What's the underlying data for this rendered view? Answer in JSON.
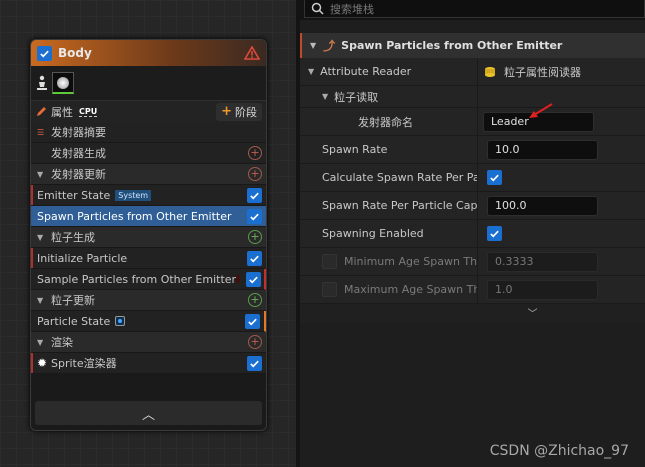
{
  "search": {
    "placeholder": "搜索堆栈"
  },
  "node": {
    "title": "Body",
    "attr_label": "属性",
    "attr_badge": "CPU",
    "stage_label": "阶段",
    "rows": [
      {
        "type": "summary",
        "label": "发射器摘要"
      },
      {
        "type": "item",
        "label": "发射器生成",
        "control": "add",
        "centered": true
      },
      {
        "type": "sect",
        "label": "发射器更新",
        "control": "add"
      },
      {
        "type": "item",
        "label": "Emitter State",
        "pill": "System",
        "control": "check",
        "bar": true
      },
      {
        "type": "item",
        "label": "Spawn Particles from Other Emitter",
        "control": "check",
        "selected": true
      },
      {
        "type": "sect",
        "label": "粒子生成",
        "control": "add-green"
      },
      {
        "type": "item",
        "label": "Initialize Particle",
        "control": "check",
        "bar": true
      },
      {
        "type": "item",
        "label": "Sample Particles from Other Emitter",
        "control": "check",
        "red": true
      },
      {
        "type": "sect",
        "label": "粒子更新",
        "control": "add-green"
      },
      {
        "type": "item",
        "label": "Particle State",
        "control": "check",
        "blue": true
      },
      {
        "type": "sect",
        "label": "渲染",
        "control": "add"
      },
      {
        "type": "item",
        "label": "Sprite渲染器",
        "control": "check",
        "spark": true,
        "bar": true
      }
    ]
  },
  "panel": {
    "title": "Spawn Particles from Other Emitter",
    "attribute_reader": {
      "label": "Attribute Reader",
      "value": "粒子属性阅读器"
    },
    "particle_read": {
      "label": "粒子读取"
    },
    "emitter_name": {
      "label": "发射器命名",
      "value": "Leader"
    },
    "spawn_rate": {
      "label": "Spawn Rate",
      "value": "10.0"
    },
    "calc_spawn": {
      "label": "Calculate Spawn Rate Per Parti"
    },
    "spawn_cap": {
      "label": "Spawn Rate Per Particle Cap",
      "value": "100.0"
    },
    "spawning_enabled": {
      "label": "Spawning Enabled"
    },
    "min_age": {
      "label": "Minimum Age Spawn Thre",
      "value": "0.3333"
    },
    "max_age": {
      "label": "Maximum Age Spawn Thr",
      "value": "1.0"
    }
  },
  "watermark": "CSDN @Zhichao_97",
  "colors": {
    "selected": "#2f5f96",
    "checkbox": "#1a6fd1",
    "header_orange": "#c96a20"
  }
}
